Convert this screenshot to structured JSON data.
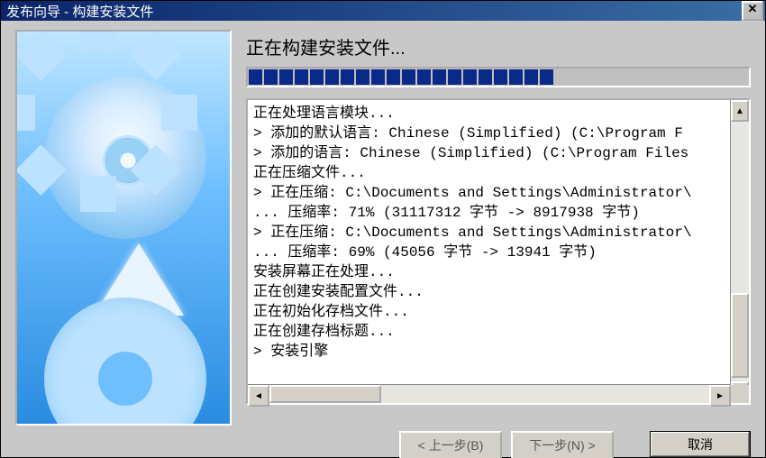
{
  "window": {
    "title": "发布向导 - 构建安装文件"
  },
  "heading": "正在构建安装文件...",
  "progress": {
    "segments": 20
  },
  "log": {
    "lines": [
      "正在处理语言模块...",
      "> 添加的默认语言: Chinese (Simplified) (C:\\Program F",
      "> 添加的语言: Chinese (Simplified) (C:\\Program Files",
      "正在压缩文件...",
      "> 正在压缩: C:\\Documents and Settings\\Administrator\\",
      "... 压缩率: 71% (31117312 字节 -> 8917938 字节)",
      "> 正在压缩: C:\\Documents and Settings\\Administrator\\",
      "... 压缩率: 69% (45056 字节 -> 13941 字节)",
      "安装屏幕正在处理...",
      "正在创建安装配置文件...",
      "正在初始化存档文件...",
      "正在创建存档标题...",
      "> 安装引擎"
    ]
  },
  "buttons": {
    "back": "< 上一步(B)",
    "next": "下一步(N) >",
    "cancel": "取消"
  }
}
